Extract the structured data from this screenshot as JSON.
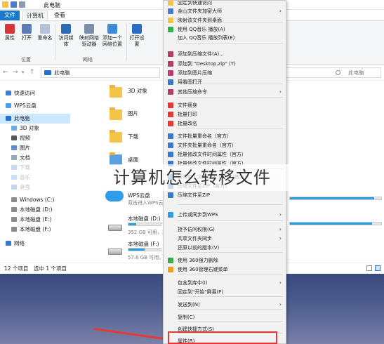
{
  "window": {
    "title": "此电脑",
    "tabs": [
      "文件",
      "计算机",
      "查看"
    ],
    "search_placeholder": "此电脑",
    "breadcrumb": "此电脑"
  },
  "ribbon": {
    "buttons": [
      "属性",
      "打开",
      "重命名",
      "访问媒体",
      "映射网络驱动器",
      "添加一个网络位置",
      "打开设置"
    ],
    "groups": [
      "位置",
      "网络"
    ]
  },
  "nav": {
    "items": [
      {
        "label": "快速访问",
        "icon": "star-icon"
      },
      {
        "label": "WPS云盘",
        "icon": "cloud-icon"
      },
      {
        "label": "此电脑",
        "icon": "pc-icon",
        "selected": true
      },
      {
        "label": "3D 对象",
        "icon": "cube-icon"
      },
      {
        "label": "视频",
        "icon": "video-icon"
      },
      {
        "label": "图片",
        "icon": "picture-icon"
      },
      {
        "label": "文档",
        "icon": "document-icon"
      },
      {
        "label": "下载",
        "icon": "download-icon"
      },
      {
        "label": "音乐",
        "icon": "music-icon"
      },
      {
        "label": "桌面",
        "icon": "desktop-icon"
      },
      {
        "label": "Windows (C:)",
        "icon": "drive-icon"
      },
      {
        "label": "本地磁盘 (D:)",
        "icon": "drive-icon"
      },
      {
        "label": "本地磁盘 (E:)",
        "icon": "drive-icon"
      },
      {
        "label": "本地磁盘 (F:)",
        "icon": "drive-icon"
      },
      {
        "label": "网络",
        "icon": "network-icon"
      }
    ]
  },
  "content": {
    "folders": [
      "3D 对象",
      "图片",
      "下载",
      "桌面"
    ],
    "cloud": {
      "name": "WPS云盘",
      "desc": "双击进入WPS云盘"
    },
    "drives": [
      {
        "name": "本地磁盘 (D:)",
        "free": "352 GB 可用，共 465 GB",
        "used_fraction": 0.24
      },
      {
        "name": "本地磁盘 (F:)",
        "free": "57.6 GB 可用，共 11",
        "used_fraction": 0.5
      }
    ]
  },
  "status": {
    "count": "12 个项目",
    "selected": "选中 1 个项目"
  },
  "context_menu": {
    "items": [
      {
        "label": "固定到快速访问",
        "submenu": false
      },
      {
        "label": "金山文件夹加密大师",
        "submenu": true
      },
      {
        "label": "映射该文件夹到桌面",
        "submenu": false
      },
      {
        "label": "使用 QQ音乐 播放(A)",
        "submenu": false
      },
      {
        "label": "加入 QQ音乐 播放列表(E)",
        "submenu": false
      },
      {
        "label": "添加到压缩文件(A)...",
        "submenu": false
      },
      {
        "label": "添加到 \"Desktop.zip\" (T)",
        "submenu": false
      },
      {
        "label": "添加到图片压缩",
        "submenu": false
      },
      {
        "label": "用看图打开",
        "submenu": false
      },
      {
        "label": "其他压缩命令",
        "submenu": true
      },
      {
        "label": "文件瘦身",
        "submenu": false
      },
      {
        "label": "批量打印",
        "submenu": false
      },
      {
        "label": "批量改名",
        "submenu": false
      },
      {
        "label": "文件批量重命名（官方）",
        "submenu": false
      },
      {
        "label": "文件夹批量重命名（官方）",
        "submenu": false
      },
      {
        "label": "批量修改文件时间属性（官方）",
        "submenu": false
      },
      {
        "label": "批量修改文件时间属性（官方）",
        "submenu": false
      },
      {
        "label": "压缩每个文件到单个ZIP（官方）",
        "submenu": false
      },
      {
        "label": "压缩文件至ZIP（官方）",
        "submenu": false
      },
      {
        "label": "压缩文件至ZIP",
        "submenu": false
      },
      {
        "label": "上传或同步到WPS",
        "submenu": true
      },
      {
        "label": "授予访问权限(G)",
        "submenu": true
      },
      {
        "label": "共享文件夹同步",
        "submenu": true
      },
      {
        "label": "还原以前的版本(V)",
        "submenu": false
      },
      {
        "label": "使用 360强力删除",
        "submenu": false
      },
      {
        "label": "使用 360管理右键菜单",
        "submenu": false
      },
      {
        "label": "包含到库中(I)",
        "submenu": true
      },
      {
        "label": "固定到\"开始\"屏幕(P)",
        "submenu": false
      },
      {
        "label": "发送到(N)",
        "submenu": true
      },
      {
        "label": "复制(C)",
        "submenu": false
      },
      {
        "label": "创建快捷方式(S)",
        "submenu": false
      },
      {
        "label": "属性(R)",
        "submenu": false
      }
    ]
  },
  "overlay_title": "计算机怎么转移文件",
  "colors": {
    "accent": "#1979ca",
    "highlight": "#e53935",
    "folder": "#f2c44a"
  }
}
